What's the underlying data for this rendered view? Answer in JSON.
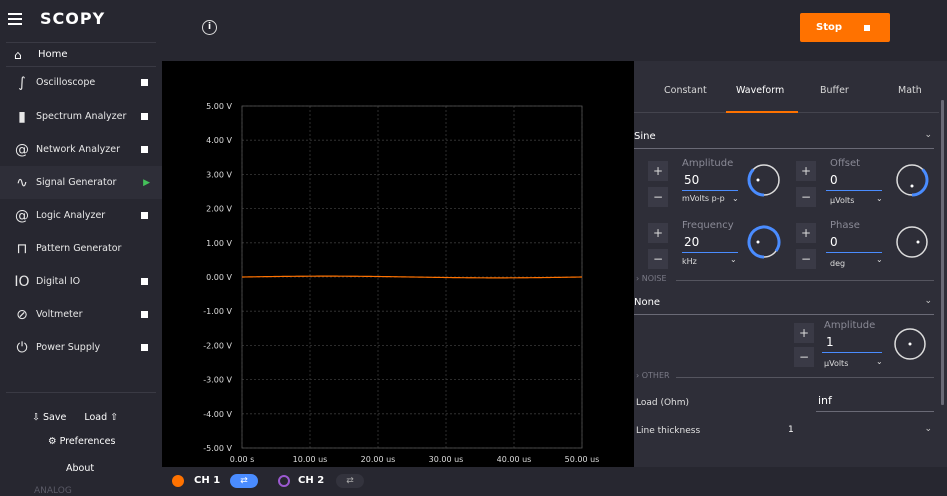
{
  "app": {
    "logo": "SCOPY",
    "home_label": "Home",
    "about": "About",
    "preferences": "Preferences",
    "save": "Save",
    "load": "Load",
    "footer_tag": "ANALOG"
  },
  "nav": [
    {
      "label": "Oscilloscope",
      "icon": "oscilloscope-icon",
      "status": "stopped"
    },
    {
      "label": "Spectrum Analyzer",
      "icon": "spectrum-icon",
      "status": "stopped"
    },
    {
      "label": "Network Analyzer",
      "icon": "network-icon",
      "status": "stopped"
    },
    {
      "label": "Signal Generator",
      "icon": "signal-generator-icon",
      "status": "running"
    },
    {
      "label": "Logic Analyzer",
      "icon": "logic-icon",
      "status": "stopped"
    },
    {
      "label": "Pattern Generator",
      "icon": "pattern-icon",
      "status": "none"
    },
    {
      "label": "Digital IO",
      "icon": "digital-io-icon",
      "status": "stopped"
    },
    {
      "label": "Voltmeter",
      "icon": "voltmeter-icon",
      "status": "stopped"
    },
    {
      "label": "Power Supply",
      "icon": "power-icon",
      "status": "stopped"
    }
  ],
  "toolbar": {
    "stop_label": "Stop",
    "accent": "#ff7200"
  },
  "plot": {
    "y_ticks": [
      "5.00 V",
      "4.00 V",
      "3.00 V",
      "2.00 V",
      "1.00 V",
      "0.00 V",
      "-1.00 V",
      "-2.00 V",
      "-3.00 V",
      "-4.00 V",
      "-5.00 V"
    ],
    "x_ticks": [
      "0.00 s",
      "10.00 us",
      "20.00 us",
      "30.00 us",
      "40.00 us",
      "50.00 us"
    ],
    "trace_color": "#ff7200"
  },
  "panel": {
    "tabs": [
      "Constant",
      "Waveform",
      "Buffer",
      "Math"
    ],
    "active_tab": "Waveform",
    "waveform_type": "Sine",
    "amplitude": {
      "title": "Amplitude",
      "value": "50",
      "unit": "mVolts p-p"
    },
    "offset": {
      "title": "Offset",
      "value": "0",
      "unit": "μVolts"
    },
    "frequency": {
      "title": "Frequency",
      "value": "20",
      "unit": "kHz"
    },
    "phase": {
      "title": "Phase",
      "value": "0",
      "unit": "deg"
    },
    "noise_section": "NOISE",
    "noise_type": "None",
    "noise_amplitude": {
      "title": "Amplitude",
      "value": "1",
      "unit": "μVolts"
    },
    "other_section": "OTHER",
    "load_label": "Load (Ohm)",
    "load_value": "inf",
    "line_thickness_label": "Line thickness",
    "line_thickness_value": "1"
  },
  "channels": [
    {
      "label": "CH 1",
      "color": "#ff7200",
      "enabled": true
    },
    {
      "label": "CH 2",
      "color": "#9b59d0",
      "enabled": false
    }
  ]
}
